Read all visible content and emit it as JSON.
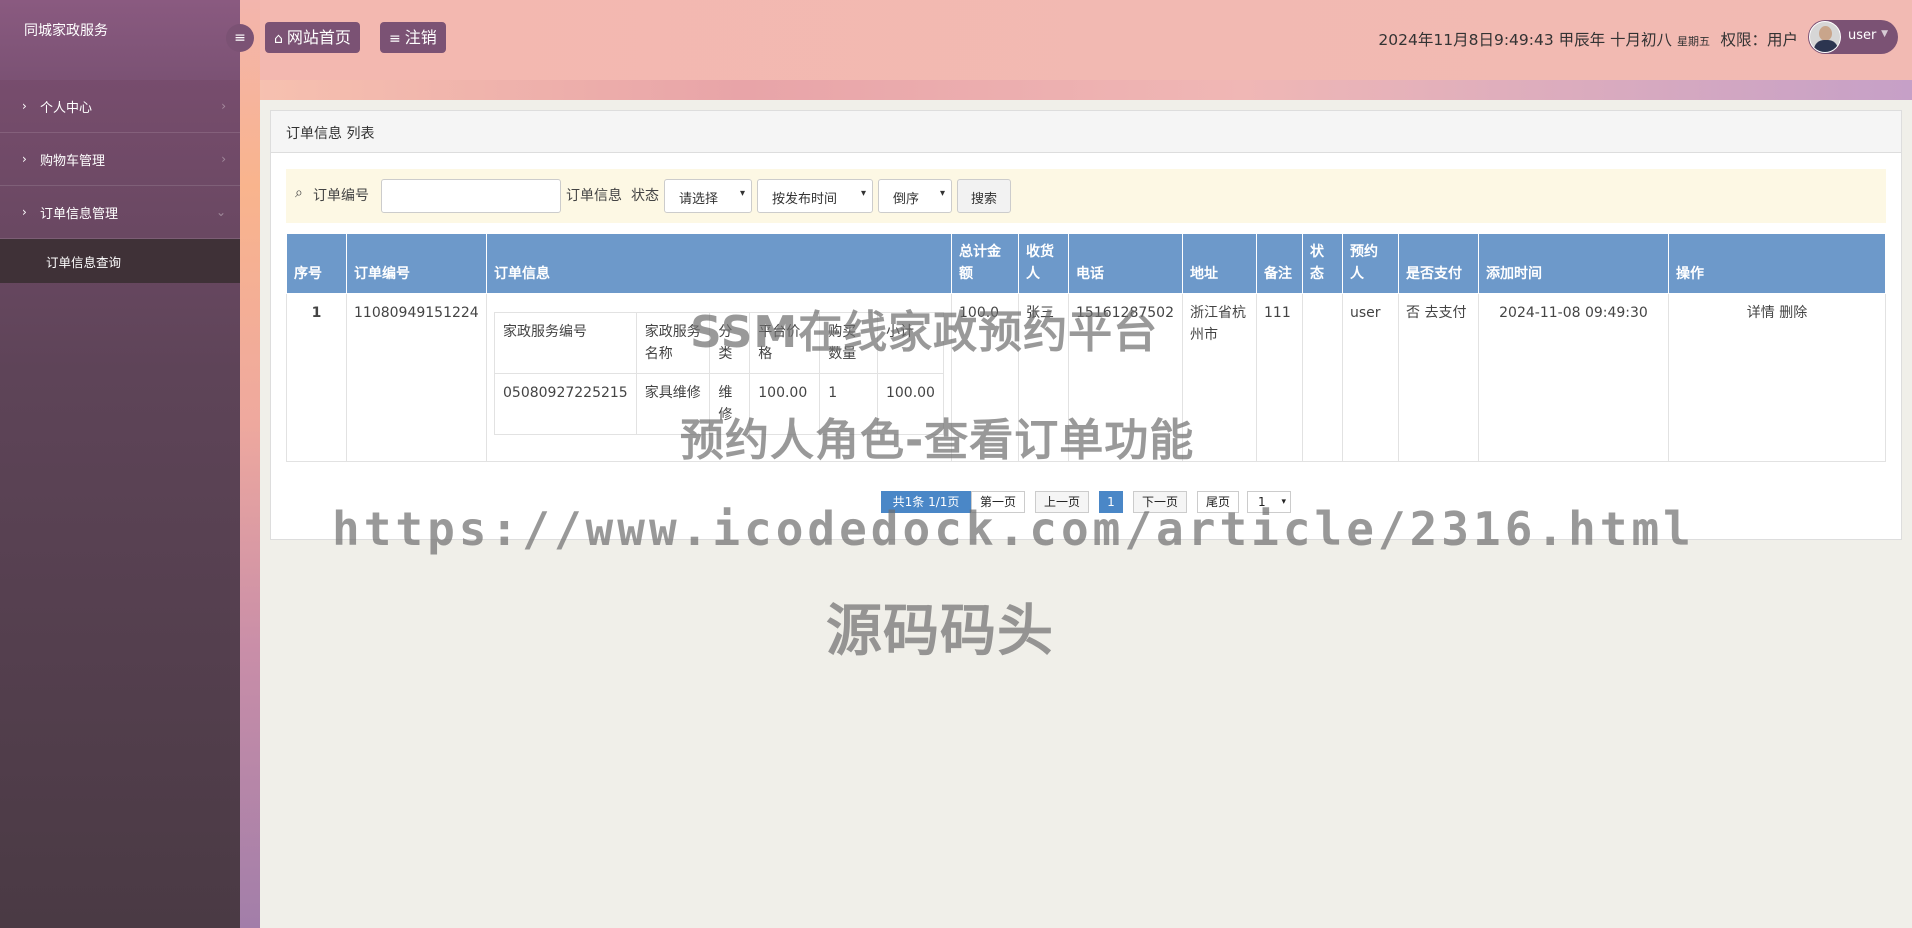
{
  "brand": "同城家政服务",
  "sidebar": {
    "items": [
      {
        "label": "个人中心"
      },
      {
        "label": "购物车管理"
      },
      {
        "label": "订单信息管理"
      }
    ],
    "sub_items": [
      {
        "label": "订单信息查询"
      }
    ]
  },
  "topbar": {
    "home_label": "网站首页",
    "logout_label": "注销",
    "datetime": "2024年11月8日9:49:43 甲辰年 十月初八",
    "weekday": "星期五",
    "permission": "权限：用户",
    "username": "user"
  },
  "panel": {
    "title": "订单信息 列表"
  },
  "search": {
    "order_no_label": "订单编号",
    "order_info_label": "订单信息",
    "status_label": "状态",
    "status_value": "请选择",
    "sort_value": "按发布时间",
    "order_value": "倒序",
    "search_button": "搜索"
  },
  "table": {
    "headers": [
      "序号",
      "订单编号",
      "订单信息",
      "总计金额",
      "收货人",
      "电话",
      "地址",
      "备注",
      "状态",
      "预约人",
      "是否支付",
      "添加时间",
      "操作"
    ],
    "rows": [
      {
        "index": "1",
        "order_no": "11080949151224",
        "inner_headers": [
          "家政服务编号",
          "家政服务名称",
          "分类",
          "平台价格",
          "购买数量",
          "小计"
        ],
        "inner_row": [
          "05080927225215",
          "家具维修",
          "维修",
          "100.00",
          "1",
          "100.00"
        ],
        "total": "100.0",
        "receiver": "张三",
        "phone": "15161287502",
        "address": "浙江省杭州市",
        "remark": "111",
        "status": "",
        "booker": "user",
        "paid": "否",
        "pay_link": "去支付",
        "added": "2024-11-08 09:49:30",
        "detail": "详情",
        "delete": "删除"
      }
    ]
  },
  "pager": {
    "summary": "共1条",
    "pages": "1/1页",
    "first": "第一页",
    "prev": "上一页",
    "current": "1",
    "next": "下一页",
    "last": "尾页",
    "jump_value": "1"
  },
  "watermarks": {
    "line1": "SSM在线家政预约平台",
    "line2": "预约人角色-查看订单功能",
    "url": "https://www.icodedock.com/article/2316.html",
    "site": "源码码头"
  }
}
